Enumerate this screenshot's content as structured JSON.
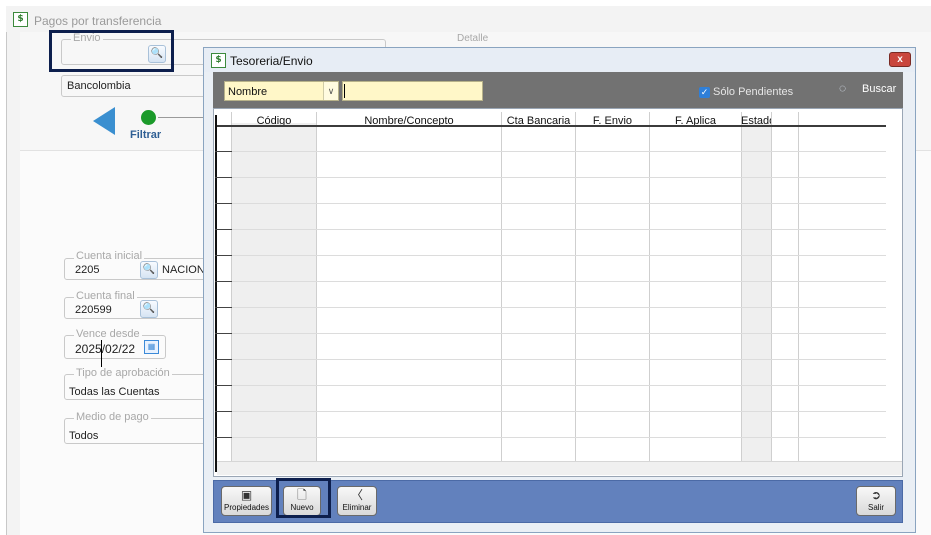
{
  "background_window": {
    "title": "Pagos por transferencia",
    "detalle_caption": "Detalle",
    "envio": {
      "caption": "Envio",
      "value": ""
    },
    "bank": "Bancolombia",
    "filter_label": "Filtrar",
    "cuenta_inicial": {
      "caption": "Cuenta inicial",
      "value": "2205",
      "extra": "NACIONA"
    },
    "cuenta_final": {
      "caption": "Cuenta final",
      "value": "220599"
    },
    "vence_desde": {
      "caption": "Vence desde",
      "value": "2025/02/22"
    },
    "tipo_aprobacion": {
      "caption": "Tipo de aprobación",
      "value": "Todas las Cuentas"
    },
    "medio_pago": {
      "caption": "Medio de pago",
      "value": "Todos"
    }
  },
  "dialog": {
    "title": "Tesoreria/Envio",
    "close_label": "x",
    "search_field": {
      "selected": "Nombre",
      "input_value": ""
    },
    "only_pending": {
      "label": "Sólo Pendientes",
      "checked": true
    },
    "search_button": "Buscar",
    "grid": {
      "columns": [
        "Código",
        "Nombre/Concepto",
        "Cta Bancaria",
        "F. Envio",
        "F. Aplica",
        "Estado"
      ],
      "row_count": 13
    },
    "buttons": {
      "propiedades": "Propiedades",
      "nuevo": "Nuevo",
      "eliminar": "Eliminar",
      "salir": "Salir"
    }
  },
  "colors": {
    "dialog_bottom_bar": "#6281bd",
    "toolbar": "#727272",
    "highlight_border": "#0d1f4d",
    "filter_dot": "#1b9a2a"
  },
  "icons": [
    "app-icon",
    "search-icon",
    "calendar-icon",
    "back-arrow-icon",
    "close-icon",
    "binoculars-icon",
    "properties-icon",
    "new-document-icon",
    "eraser-icon",
    "exit-icon"
  ]
}
